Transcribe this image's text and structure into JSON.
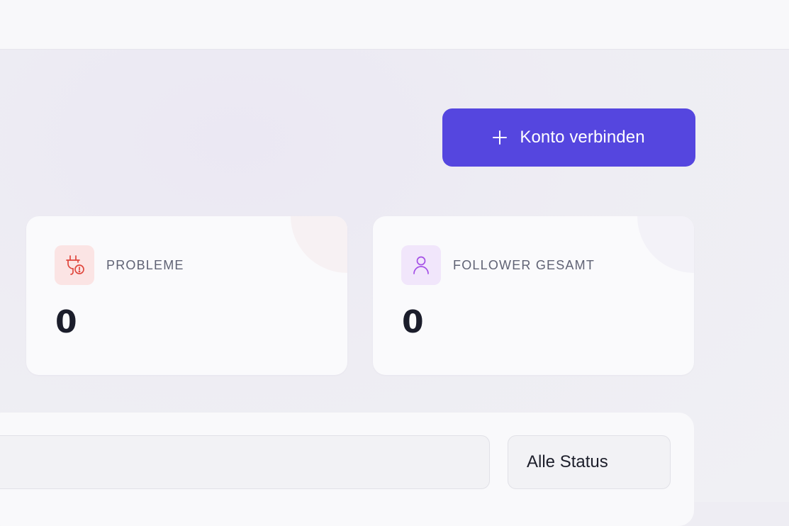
{
  "header": {
    "connect_button_label": "Konto verbinden",
    "connect_button_icon": "plus-icon"
  },
  "stats": [
    {
      "label": "PROBLEME",
      "value": "0",
      "icon": "plug-warning-icon",
      "accent": "#e0473d"
    },
    {
      "label": "FOLLOWER GESAMT",
      "value": "0",
      "icon": "user-icon",
      "accent": "#a44fe6"
    }
  ],
  "filters": {
    "search_value": "",
    "status_select": "Alle Status"
  },
  "colors": {
    "primary": "#5546df",
    "card_background": "#fafafc",
    "page_background": "#eeedf3"
  }
}
